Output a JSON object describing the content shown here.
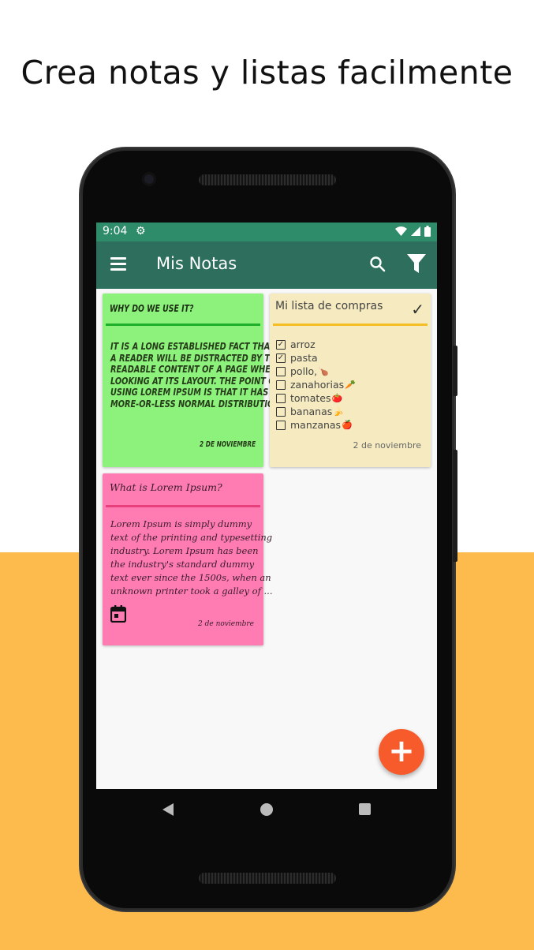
{
  "headline": "Crea notas y listas facilmente",
  "colors": {
    "accent_bg": "#FDBA4D",
    "statusbar": "#2F8C6A",
    "appbar": "#2D6E5D",
    "fab": "#F85B2B"
  },
  "statusbar": {
    "time": "9:04",
    "icons": [
      "gear-icon",
      "wifi-icon",
      "signal-icon",
      "battery-icon"
    ]
  },
  "appbar": {
    "title": "Mis Notas",
    "icons": [
      "menu-icon",
      "search-icon",
      "filter-icon"
    ]
  },
  "notes": {
    "green": {
      "title": "WHY DO WE USE IT?",
      "body_lines": [
        "IT IS A LONG ESTABLISHED FACT THAT",
        "A READER WILL BE DISTRACTED BY THE",
        "READABLE CONTENT OF A PAGE WHEN",
        "LOOKING AT ITS LAYOUT. THE POINT OF",
        "USING LOREM IPSUM IS THAT IT HAS A",
        "MORE-OR-LESS NORMAL DISTRIBUTION..."
      ],
      "date": "2 DE NOVIEMBRE"
    },
    "yellow": {
      "title": "Mi lista de compras",
      "items": [
        {
          "label": "arroz",
          "checked": true,
          "emoji": ""
        },
        {
          "label": "pasta",
          "checked": true,
          "emoji": ""
        },
        {
          "label": "pollo,",
          "checked": false,
          "emoji": "🍗"
        },
        {
          "label": "zanahorias",
          "checked": false,
          "emoji": "🥕"
        },
        {
          "label": "tomates",
          "checked": false,
          "emoji": "🍅"
        },
        {
          "label": "bananas",
          "checked": false,
          "emoji": "🍌"
        },
        {
          "label": "manzanas",
          "checked": false,
          "emoji": "🍎"
        }
      ],
      "date": "2 de noviembre"
    },
    "pink": {
      "title": "What is Lorem Ipsum?",
      "body_lines": [
        "Lorem Ipsum is simply dummy",
        "text of the printing and typesetting",
        "industry. Lorem Ipsum has been",
        "the industry's standard dummy",
        "text ever since the 1500s, when an",
        "unknown printer took a galley of ..."
      ],
      "date": "2 de noviembre"
    }
  },
  "fab": {
    "label": "+"
  }
}
